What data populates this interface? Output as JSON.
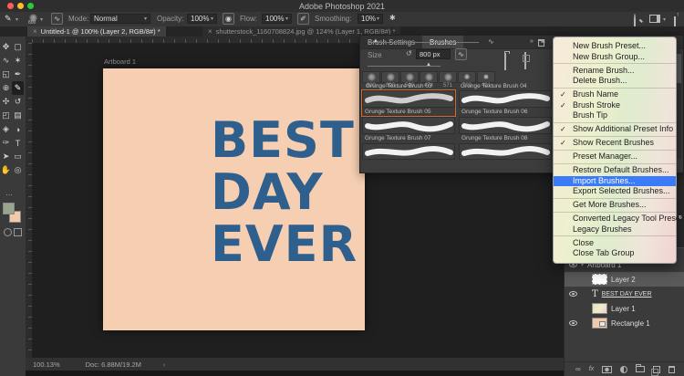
{
  "window": {
    "title": "Adobe Photoshop 2021"
  },
  "options_bar": {
    "preset_size": "800",
    "mode_label": "Mode:",
    "mode_value": "Normal",
    "opacity_label": "Opacity:",
    "opacity_value": "100%",
    "flow_label": "Flow:",
    "flow_value": "100%",
    "smoothing_label": "Smoothing:",
    "smoothing_value": "10%"
  },
  "document_tabs": {
    "close_glyph": "×",
    "items": [
      {
        "label": "Untitled-1 @ 100% (Layer 2, RGB/8#) *",
        "active": true
      },
      {
        "label": "shutterstock_1160708824.jpg @ 124% (Layer 1, RGB/8#) *",
        "active": false
      }
    ]
  },
  "toolbar": {
    "more_glyph": "…",
    "tools": [
      {
        "name": "move",
        "glyph": "✥"
      },
      {
        "name": "marquee",
        "glyph": "▢"
      },
      {
        "name": "lasso",
        "glyph": "∿"
      },
      {
        "name": "quick-selection",
        "glyph": "✶"
      },
      {
        "name": "crop",
        "glyph": "◱"
      },
      {
        "name": "eyedropper",
        "glyph": "✒"
      },
      {
        "name": "healing-brush",
        "glyph": "⊕"
      },
      {
        "name": "brush",
        "glyph": "✎"
      },
      {
        "name": "clone-stamp",
        "glyph": "✣"
      },
      {
        "name": "history-brush",
        "glyph": "↺"
      },
      {
        "name": "eraser",
        "glyph": "◰"
      },
      {
        "name": "gradient",
        "glyph": "▤"
      },
      {
        "name": "blur",
        "glyph": "◈"
      },
      {
        "name": "dodge",
        "glyph": "◑"
      },
      {
        "name": "pen",
        "glyph": "✑"
      },
      {
        "name": "type",
        "glyph": "T"
      },
      {
        "name": "path-selection",
        "glyph": "➤"
      },
      {
        "name": "shape",
        "glyph": "▭"
      },
      {
        "name": "hand",
        "glyph": "✋"
      },
      {
        "name": "zoom",
        "glyph": "◎"
      }
    ]
  },
  "canvas": {
    "artboard_label": "Artboard 1",
    "lines": [
      "BEST",
      "DAY",
      "EVER"
    ]
  },
  "brushes_panel": {
    "tab_settings": "Brush Settings",
    "tab_brushes": "Brushes",
    "size_label": "Size",
    "size_value": "800 px",
    "recent": [
      {
        "size": "800"
      },
      {
        "size": "800"
      },
      {
        "size": "500"
      },
      {
        "size": "474"
      },
      {
        "size": "571"
      },
      {
        "size": "700"
      },
      {
        "size": "401"
      }
    ],
    "partial_row": [
      "Grunge Texture Brush 03",
      "Grunge Texture Brush 04"
    ],
    "rows": [
      [
        "Grunge Texture Brush 05",
        "Grunge Texture Brush 06"
      ],
      [
        "Grunge Texture Brush 07",
        "Grunge Texture Brush 08"
      ]
    ],
    "selected_brush": "Grunge Texture Brush 05"
  },
  "menu": {
    "items": [
      {
        "label": "New Brush Preset...",
        "check": ""
      },
      {
        "label": "New Brush Group...",
        "check": ""
      },
      {
        "label": "Rename Brush...",
        "check": ""
      },
      {
        "label": "Delete Brush...",
        "check": ""
      },
      {
        "label": "Brush Name",
        "check": "✓"
      },
      {
        "label": "Brush Stroke",
        "check": "✓"
      },
      {
        "label": "Brush Tip",
        "check": ""
      },
      {
        "label": "Show Additional Preset Info",
        "check": "✓"
      },
      {
        "label": "Show Recent Brushes",
        "check": "✓"
      },
      {
        "label": "Preset Manager...",
        "check": ""
      },
      {
        "label": "Restore Default Brushes...",
        "check": ""
      },
      {
        "label": "Import Brushes...",
        "check": "",
        "selected": true
      },
      {
        "label": "Export Selected Brushes...",
        "check": ""
      },
      {
        "label": "Get More Brushes...",
        "check": ""
      },
      {
        "label": "Converted Legacy Tool Presets",
        "check": ""
      },
      {
        "label": "Legacy Brushes",
        "check": ""
      },
      {
        "label": "Close",
        "check": ""
      },
      {
        "label": "Close Tab Group",
        "check": ""
      }
    ]
  },
  "layers_panel": {
    "rows": [
      {
        "name": "Artboard 1",
        "eye": true
      },
      {
        "name": "Layer 2",
        "eye": false,
        "selected": true
      },
      {
        "name": "BEST DAY EVER",
        "eye": true
      },
      {
        "name": "Layer 1",
        "eye": false
      },
      {
        "name": "Rectangle 1",
        "eye": true
      }
    ],
    "selected_layer": "Layer 2"
  },
  "status_bar": {
    "zoom": "100.13%",
    "doc": "Doc: 6.88M/19.2M",
    "chevron": "›"
  },
  "colors": {
    "accent_blue": "#3b7bf7",
    "canvas_bg": "#f6cfb2",
    "canvas_text": "#2f5f8d",
    "brush_selected_border": "#d06a2b",
    "foreground_swatch": "#9aa58e",
    "background_swatch": "#f2c9a9"
  }
}
